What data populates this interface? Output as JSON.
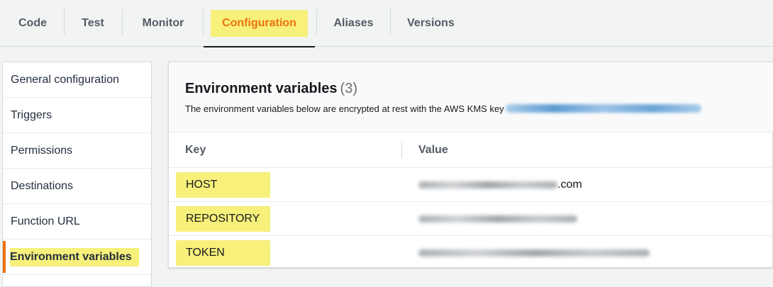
{
  "tabs": [
    {
      "label": "Code",
      "active": false
    },
    {
      "label": "Test",
      "active": false
    },
    {
      "label": "Monitor",
      "active": false
    },
    {
      "label": "Configuration",
      "active": true
    },
    {
      "label": "Aliases",
      "active": false
    },
    {
      "label": "Versions",
      "active": false
    }
  ],
  "sidebar": {
    "items": [
      {
        "label": "General configuration",
        "active": false
      },
      {
        "label": "Triggers",
        "active": false
      },
      {
        "label": "Permissions",
        "active": false
      },
      {
        "label": "Destinations",
        "active": false
      },
      {
        "label": "Function URL",
        "active": false
      },
      {
        "label": "Environment variables",
        "active": true
      }
    ]
  },
  "panel": {
    "title": "Environment variables",
    "count": "(3)",
    "description": "The environment variables below are encrypted at rest with the AWS KMS key"
  },
  "table": {
    "headers": {
      "key": "Key",
      "value": "Value"
    },
    "rows": [
      {
        "key": "HOST",
        "value_visible_suffix": ".com"
      },
      {
        "key": "REPOSITORY",
        "value_visible_suffix": ""
      },
      {
        "key": "TOKEN",
        "value_visible_suffix": ""
      }
    ]
  },
  "colors": {
    "highlight": "#f7f07a",
    "accent": "#ec7211",
    "link": "#0073bb",
    "border": "#d5dbdb"
  }
}
